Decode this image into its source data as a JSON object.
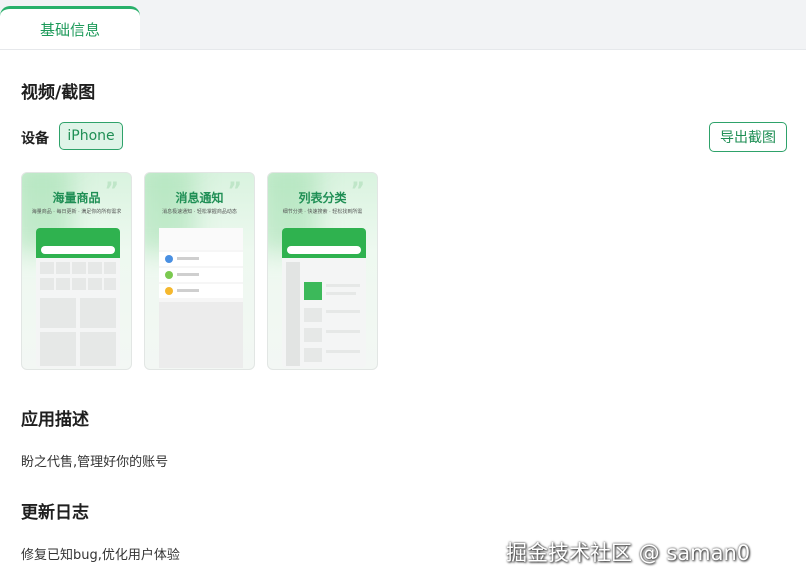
{
  "tabs": [
    {
      "label": "基础信息",
      "active": true
    }
  ],
  "sections": {
    "media_title": "视频/截图",
    "device_label": "设备",
    "device_selected": "iPhone",
    "export_label": "导出截图",
    "desc_title": "应用描述",
    "desc_text": "盼之代售,管理好你的账号",
    "changelog_title": "更新日志",
    "changelog_text": "修复已知bug,优化用户体验"
  },
  "screenshots": [
    {
      "title": "海量商品",
      "subtitle": "海量商品 · 每日更新 · 满足你的所有需求"
    },
    {
      "title": "消息通知",
      "subtitle": "消息极速通知 · 轻松掌握商品动态"
    },
    {
      "title": "列表分类",
      "subtitle": "细节分类 · 快速搜索 · 轻松找到所需"
    }
  ],
  "watermark": "掘金技术社区 @ saman0",
  "colors": {
    "accent": "#29b06a",
    "accent_bg": "#dff4e8"
  }
}
